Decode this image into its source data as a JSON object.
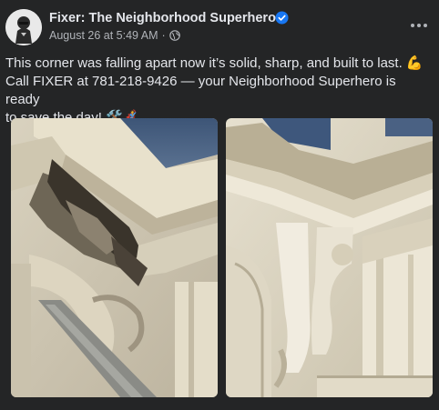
{
  "post": {
    "page_name": "Fixer: The Neighborhood Superhero",
    "timestamp": "August 26 at 5:49 AM",
    "separator": "·",
    "message": {
      "line1": "This corner was falling apart now it’s solid, sharp, and built to last. 💪",
      "line2": "Call FIXER at 781-218-9426 — your Neighborhood Superhero is ready",
      "line3": "to save the day! 🛠️🦸"
    },
    "icons": {
      "verified": "verified-badge-icon",
      "audience": "globe-icon",
      "more": "more-options-icon"
    },
    "photos": [
      {
        "name": "before-photo"
      },
      {
        "name": "after-photo"
      }
    ],
    "colors": {
      "background": "#242526",
      "primary_text": "#e4e6eb",
      "secondary_text": "#b0b3b8",
      "verified": "#1877f2"
    }
  }
}
